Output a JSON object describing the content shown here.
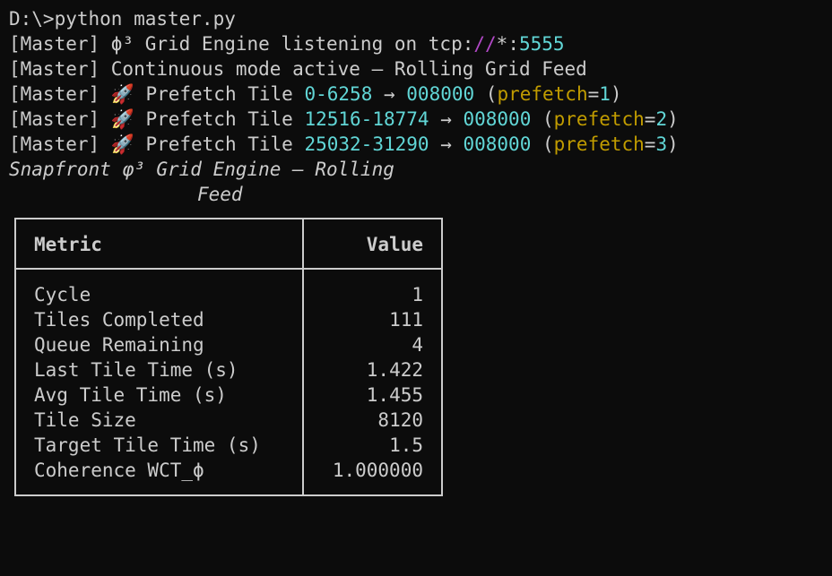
{
  "prompt_line": "D:\\>python master.py",
  "log": {
    "listen_prefix": "[Master] ϕ³ Grid Engine listening on tcp:",
    "listen_slashes": "//",
    "listen_star": "*:",
    "listen_port": "5555",
    "continuous": "[Master] Continuous mode active — Rolling Grid Feed",
    "prefetch": [
      {
        "prefix": "[Master] ",
        "icon": "rocket-icon",
        "label": " Prefetch Tile ",
        "start": "0",
        "dash": "-",
        "end": "6258",
        "arrow": " → ",
        "target": "008000",
        "open": " (",
        "key": "prefetch",
        "eq": "=",
        "num": "1",
        "close": ")"
      },
      {
        "prefix": "[Master] ",
        "icon": "rocket-icon",
        "label": " Prefetch Tile ",
        "start": "12516",
        "dash": "-",
        "end": "18774",
        "arrow": " → ",
        "target": "008000",
        "open": " (",
        "key": "prefetch",
        "eq": "=",
        "num": "2",
        "close": ")"
      },
      {
        "prefix": "[Master] ",
        "icon": "rocket-icon",
        "label": " Prefetch Tile ",
        "start": "25032",
        "dash": "-",
        "end": "31290",
        "arrow": " → ",
        "target": "008000",
        "open": " (",
        "key": "prefetch",
        "eq": "=",
        "num": "3",
        "close": ")"
      }
    ]
  },
  "table": {
    "title_line1": "Snapfront φ³ Grid Engine — Rolling",
    "title_line2": "Feed",
    "headers": {
      "metric": "Metric",
      "value": "Value"
    },
    "rows": [
      {
        "metric": "Cycle",
        "value": "1"
      },
      {
        "metric": "Tiles Completed",
        "value": "111"
      },
      {
        "metric": "Queue Remaining",
        "value": "4"
      },
      {
        "metric": "Last Tile Time (s)",
        "value": "1.422"
      },
      {
        "metric": "Avg Tile Time (s)",
        "value": "1.455"
      },
      {
        "metric": "Tile Size",
        "value": "8120"
      },
      {
        "metric": "Target Tile Time (s)",
        "value": "1.5"
      },
      {
        "metric": "Coherence WCT_ϕ",
        "value": "1.000000"
      }
    ]
  },
  "colors": {
    "background": "#0c0c0c",
    "text": "#cccccc",
    "cyan": "#61d6d6",
    "purple": "#b148c6",
    "yellow": "#c19c00"
  }
}
